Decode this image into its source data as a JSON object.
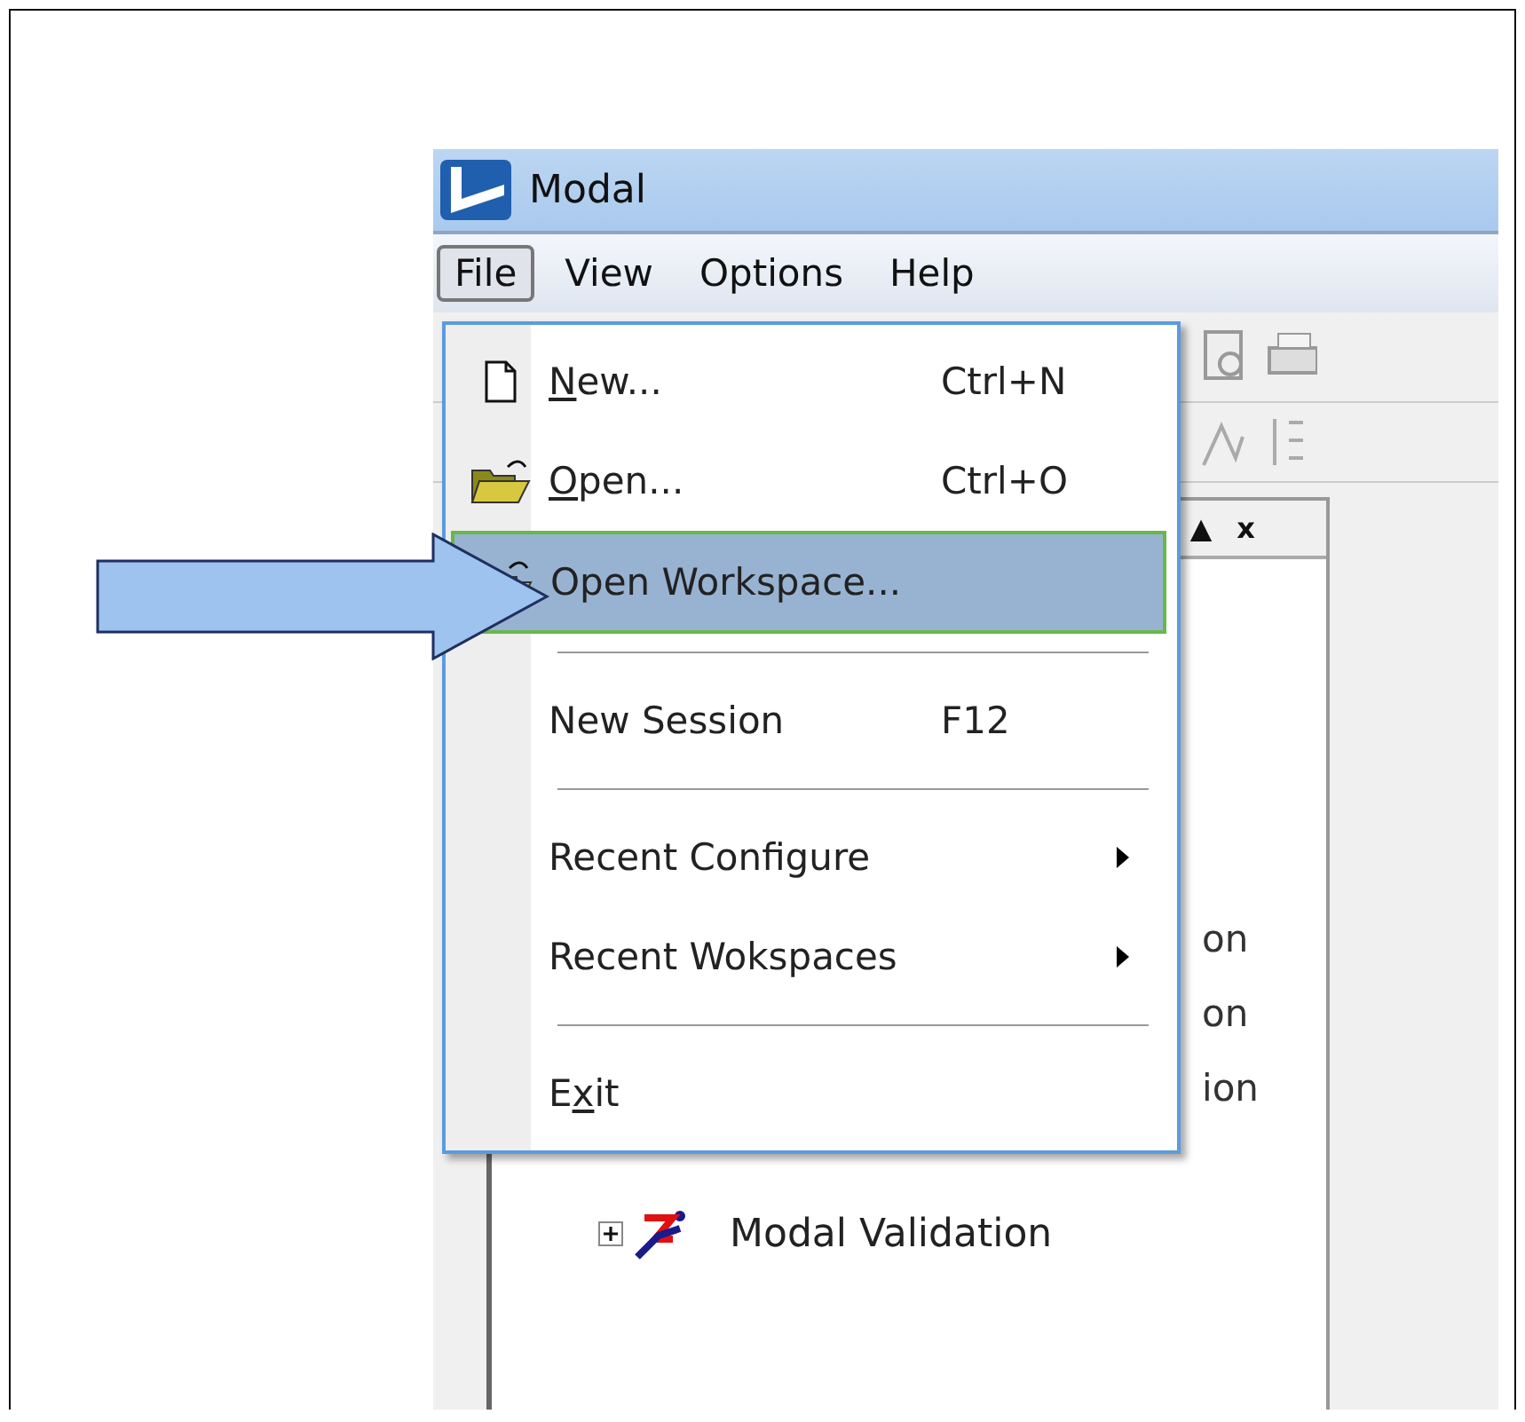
{
  "window": {
    "title": "Modal"
  },
  "menu_bar": [
    {
      "label": "File",
      "selected": true
    },
    {
      "label": "View",
      "selected": false
    },
    {
      "label": "Options",
      "selected": false
    },
    {
      "label": "Help",
      "selected": false
    }
  ],
  "panel": {
    "header_buttons": [
      "▲",
      "x"
    ],
    "tree_fragments": [
      "on",
      "on",
      "ion"
    ],
    "tree_items": [
      {
        "label": "Modal Validation",
        "expanded": false
      }
    ]
  },
  "file_menu": [
    {
      "kind": "item",
      "access_key": "N",
      "label_end": "ew...",
      "shortcut": "Ctrl+N",
      "selected": false
    },
    {
      "kind": "item",
      "access_key": "O",
      "label_end": "pen...",
      "shortcut": "Ctrl+O",
      "selected": false
    },
    {
      "kind": "item",
      "label_start": "Open Workspace...",
      "selected": true
    },
    {
      "kind": "separator"
    },
    {
      "kind": "item",
      "label_start": "New Session",
      "shortcut": "F12",
      "selected": false
    },
    {
      "kind": "separator"
    },
    {
      "kind": "submenu",
      "label_start": "Recent Configure",
      "selected": false
    },
    {
      "kind": "submenu",
      "label_start": "Recent Wokspaces",
      "selected": false
    },
    {
      "kind": "separator"
    },
    {
      "kind": "item",
      "label_start": "E",
      "access_key": "x",
      "label_end": "it",
      "selected": false
    }
  ]
}
